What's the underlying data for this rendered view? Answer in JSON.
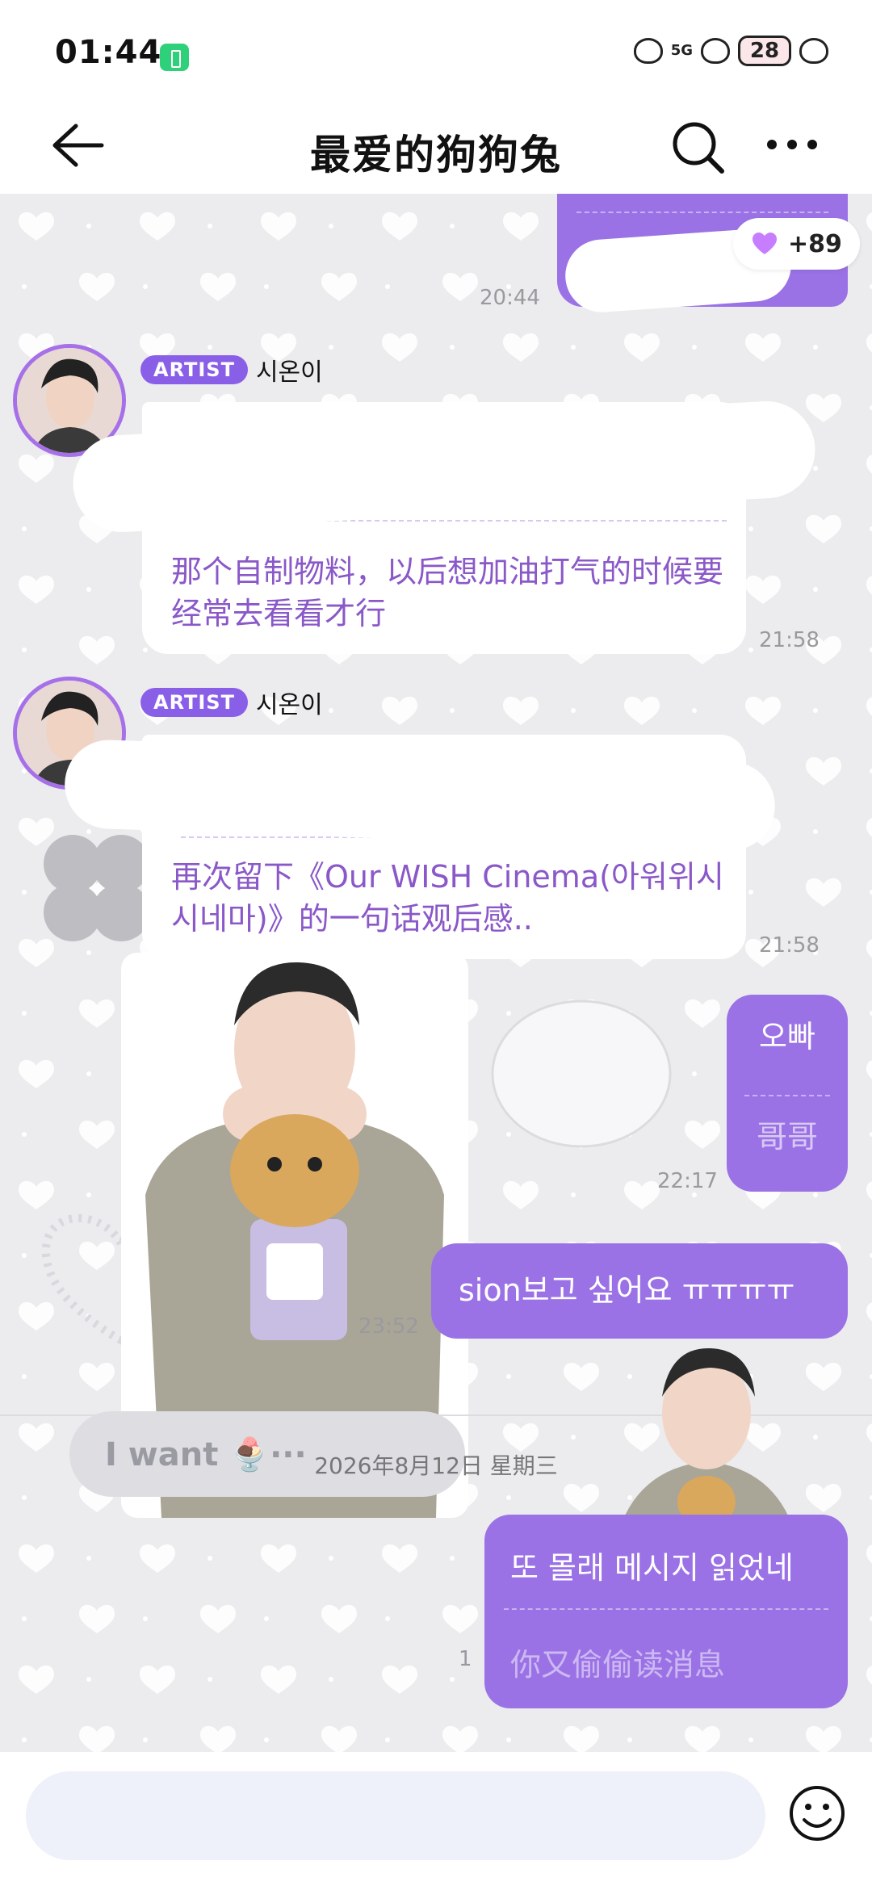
{
  "status_bar": {
    "time": "01:44",
    "network": "5G",
    "battery": "28"
  },
  "header": {
    "title": "最爱的狗狗兔"
  },
  "messages": {
    "m1_reaction_count": "+89",
    "m1_time": "20:44",
    "artist_badge": "ARTIST",
    "artist_name": "시온이",
    "m2_text": "那个自制物料，以后想加油打气的时候要经常去看看才行",
    "m2_time": "21:58",
    "m3_text": "再次留下《Our WISH Cinema(아워위시시네마)》的一句话观后感..",
    "m3_time": "21:58",
    "m4_text": "오빠",
    "m4_translation": "哥哥",
    "m4_time": "22:17",
    "m5_text": "sion보고 싶어요 ㅠㅠㅠㅠ",
    "sticker_time": "23:52",
    "sticker_text": "I want 🍨···",
    "date_divider": "2026年8月12日 星期三",
    "m6_text": "또 몰래 메시지 읽었네",
    "m6_translation": "你又偷偷读消息",
    "m6_unread": "1"
  },
  "colors": {
    "accent_purple": "#9b72e6",
    "artist_badge": "#8a5fe8",
    "translation_text": "#8a58c8",
    "battery_badge": "#2fd07a"
  },
  "icons": [
    "back-arrow-icon",
    "search-icon",
    "more-icon",
    "heart-reaction-icon",
    "emoji-icon"
  ]
}
